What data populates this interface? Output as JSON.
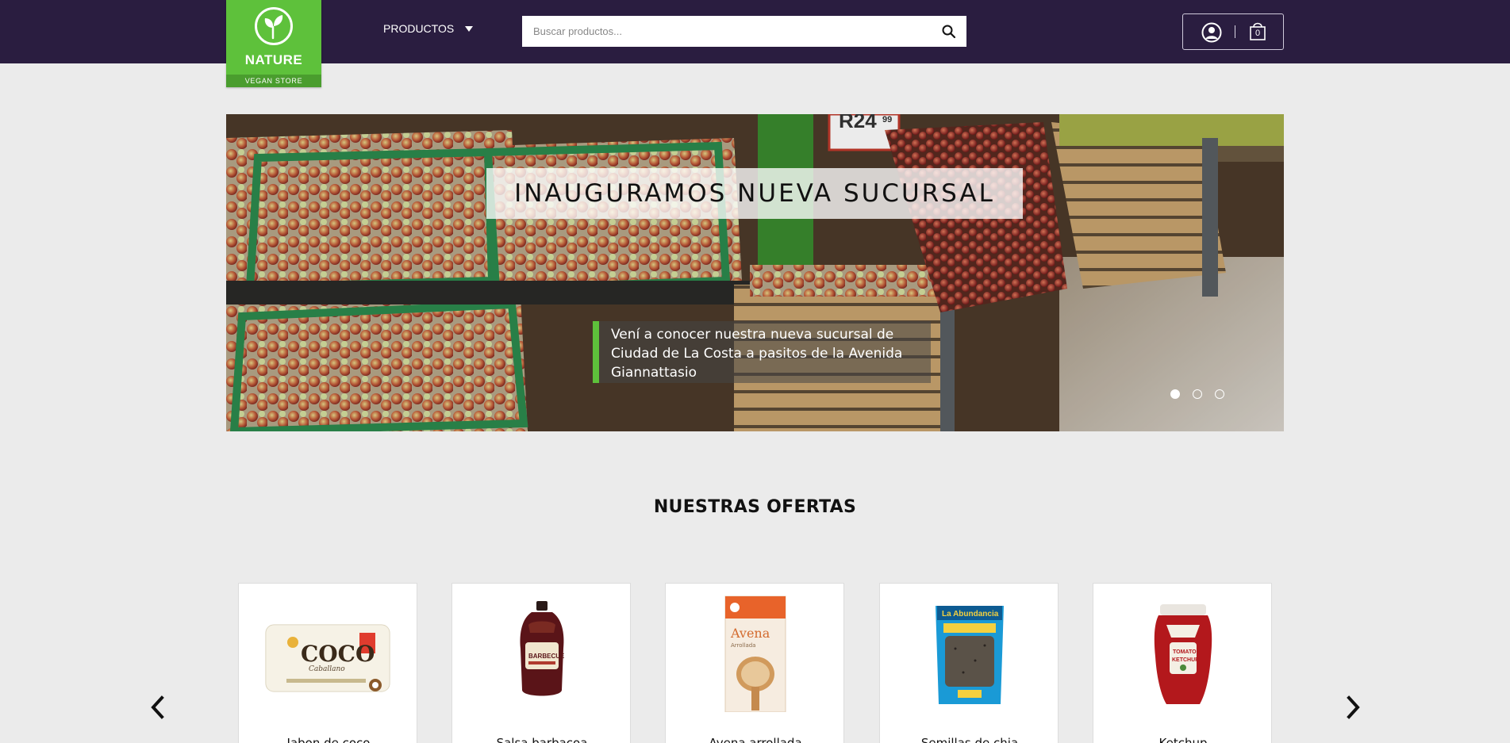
{
  "logo": {
    "title": "NATURE",
    "subtitle": "VEGAN STORE"
  },
  "nav": {
    "products_label": "PRODUCTOS"
  },
  "search": {
    "placeholder": "Buscar productos...",
    "value": ""
  },
  "cart": {
    "count": "0"
  },
  "hero": {
    "title": "INAUGURAMOS NUEVA SUCURSAL",
    "description": "Vení a conocer nuestra nueva sucursal de Ciudad de La Costa a pasitos de la Avenida Giannattasio",
    "active_slide": 1,
    "slides": 3
  },
  "offers": {
    "title": "NUESTRAS OFERTAS",
    "products": [
      {
        "name": "Jabon de coco",
        "image": "coconut-soap"
      },
      {
        "name": "Salsa barbacoa",
        "image": "bbq-sauce"
      },
      {
        "name": "Avena arrollada",
        "image": "rolled-oats"
      },
      {
        "name": "Semillas de chia",
        "image": "chia-seeds"
      },
      {
        "name": "Ketchup",
        "image": "ketchup"
      }
    ]
  },
  "colors": {
    "header": "#2a1d40",
    "accent": "#5ec13b",
    "background": "#ebebeb"
  }
}
